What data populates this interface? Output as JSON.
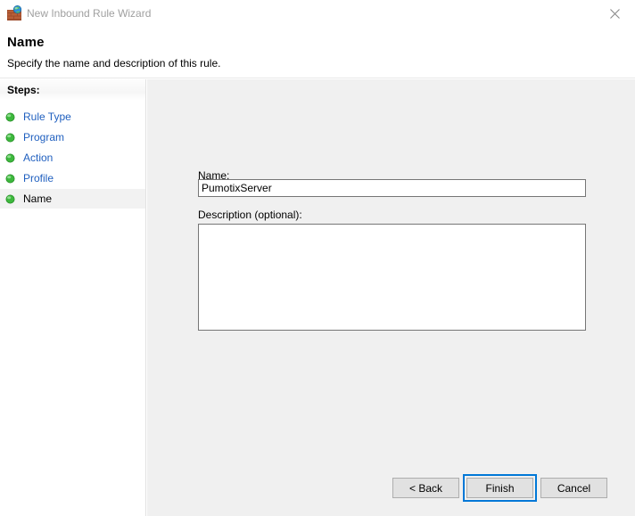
{
  "window": {
    "title": "New Inbound Rule Wizard",
    "icon": "firewall-globe-icon",
    "close_label": "✕",
    "title_color": "#a0a0a0"
  },
  "header": {
    "title": "Name",
    "subtitle": "Specify the name and description of this rule."
  },
  "sidebar": {
    "heading": "Steps:",
    "items": [
      {
        "label": "Rule Type",
        "state": "completed",
        "icon": "green-bullet-icon"
      },
      {
        "label": "Program",
        "state": "completed",
        "icon": "green-bullet-icon"
      },
      {
        "label": "Action",
        "state": "completed",
        "icon": "green-bullet-icon"
      },
      {
        "label": "Profile",
        "state": "completed",
        "icon": "green-bullet-icon"
      },
      {
        "label": "Name",
        "state": "current",
        "icon": "green-bullet-icon"
      }
    ],
    "link_color": "#1f5fbf",
    "current_color": "#000000",
    "current_row_bg": "#f2f2f2"
  },
  "form": {
    "name_label": "Name:",
    "name_value": "PumotixServer",
    "name_placeholder": "",
    "description_label": "Description (optional):",
    "description_value": "",
    "description_placeholder": ""
  },
  "buttons": {
    "back": "< Back",
    "finish": "Finish",
    "cancel": "Cancel",
    "focused": "Finish",
    "focus_color": "#0078d7"
  },
  "colors": {
    "content_bg": "#f0f0f0",
    "sidebar_bg": "#ffffff",
    "field_border": "#767676",
    "button_bg": "#e1e1e1",
    "button_border": "#adadad"
  }
}
